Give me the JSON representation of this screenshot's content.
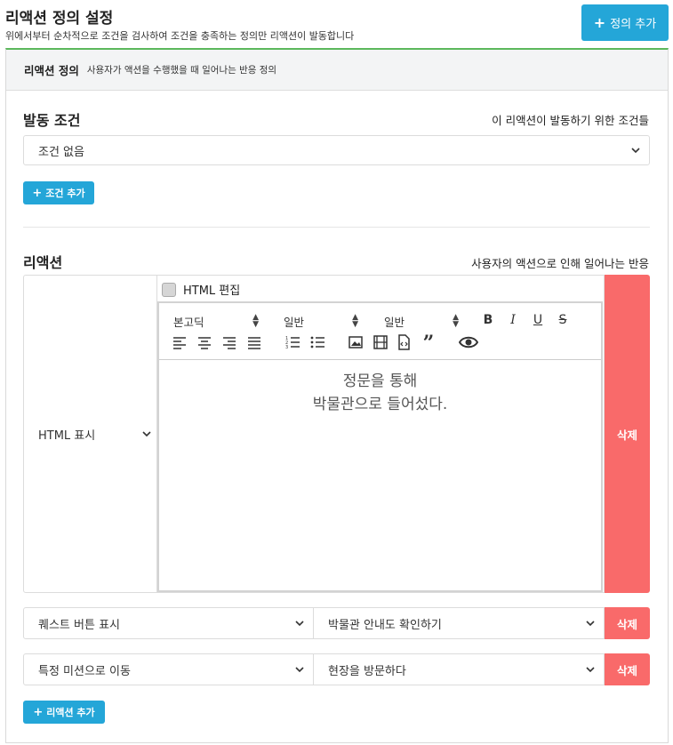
{
  "header": {
    "title": "리액션 정의 설정",
    "subtitle": "위에서부터 순차적으로 조건을 검사하여 조건을 충족하는 정의만 리액션이 발동합니다",
    "add_button": "정의 추가"
  },
  "panel": {
    "title": "리액션 정의",
    "desc": "사용자가 액션을 수행했을 때 일어나는 반응 정의"
  },
  "conditions": {
    "title": "발동 조건",
    "desc": "이 리액션이 발동하기 위한 조건들",
    "select_value": "조건 없음",
    "add_button": "조건 추가"
  },
  "reactions": {
    "title": "리액션",
    "desc": "사용자의 액션으로 인해 일어나는 반응",
    "add_button": "리액션 추가",
    "items": [
      {
        "type": "HTML 표시",
        "delete_label": "삭제",
        "html_edit_label": "HTML 편집",
        "toolbar": {
          "font": "본고딕",
          "size": "일반",
          "heading": "일반"
        },
        "content_lines": [
          "정문을 통해",
          "박물관으로 들어섰다."
        ]
      },
      {
        "type": "퀘스트 버튼 표시",
        "value": "박물관 안내도 확인하기",
        "delete_label": "삭제"
      },
      {
        "type": "특정 미션으로 이동",
        "value": "현장을 방문하다",
        "delete_label": "삭제"
      }
    ]
  },
  "colors": {
    "primary": "#24a6d8",
    "danger": "#f96a6a",
    "panel_top_border": "#5cb85c"
  }
}
